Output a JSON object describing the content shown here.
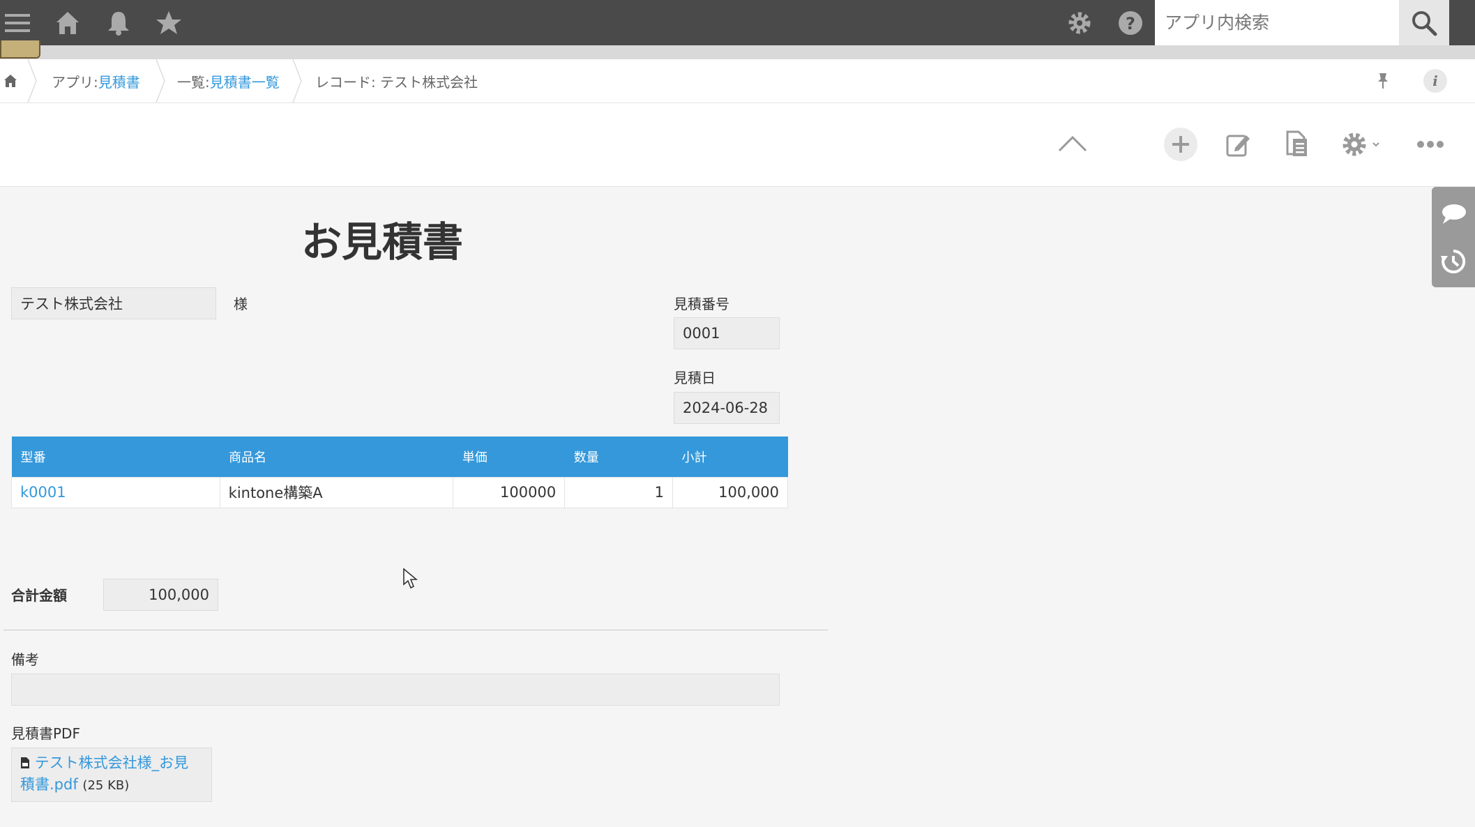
{
  "search": {
    "placeholder": "アプリ内検索"
  },
  "breadcrumb": {
    "app_prefix": "アプリ: ",
    "app_name": "見積書",
    "list_prefix": "一覧: ",
    "list_name": "見積書一覧",
    "record_label": "レコード: テスト株式会社"
  },
  "form": {
    "title": "お見積書",
    "customer": {
      "value": "テスト株式会社",
      "suffix": "様"
    },
    "quote_number": {
      "label": "見積番号",
      "value": "0001"
    },
    "quote_date": {
      "label": "見積日",
      "value": "2024-06-28"
    },
    "table": {
      "headers": [
        "型番",
        "商品名",
        "単価",
        "数量",
        "小計"
      ],
      "rows": [
        [
          "k0001",
          "kintone構築A",
          "100000",
          "1",
          "100,000"
        ]
      ]
    },
    "total": {
      "label": "合計金額",
      "value": "100,000"
    },
    "remarks": {
      "label": "備考",
      "value": ""
    },
    "pdf": {
      "label": "見積書PDF",
      "filename_line1": "テスト株式会社様_お見",
      "filename_line2": "積書.pdf",
      "size": "(25 KB)"
    }
  },
  "colors": {
    "topbar": "#4a4a4a",
    "accent": "#3498db",
    "field_bg": "#ededed"
  },
  "icons": {
    "topbar": [
      "menu-icon",
      "home-icon",
      "bell-icon",
      "star-icon",
      "gear-icon",
      "help-icon",
      "search-icon"
    ],
    "toolbar": [
      "chevron-up-icon",
      "plus-icon",
      "edit-icon",
      "copy-icon",
      "gear-icon",
      "more-icon"
    ],
    "side": [
      "comment-icon",
      "history-icon"
    ]
  }
}
